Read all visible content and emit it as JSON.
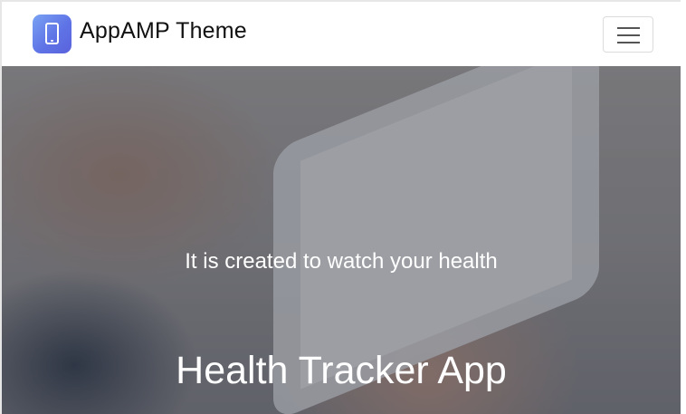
{
  "navbar": {
    "brand": "AppAMP Theme",
    "logo_icon": "mobile-phone-icon",
    "menu_icon": "hamburger-menu-icon"
  },
  "hero": {
    "subtitle": "It is created to watch your health",
    "title": "Health Tracker App"
  },
  "colors": {
    "logo_gradient_start": "#7aa3f4",
    "logo_gradient_end": "#5a62dc",
    "hero_text": "#ffffff"
  }
}
